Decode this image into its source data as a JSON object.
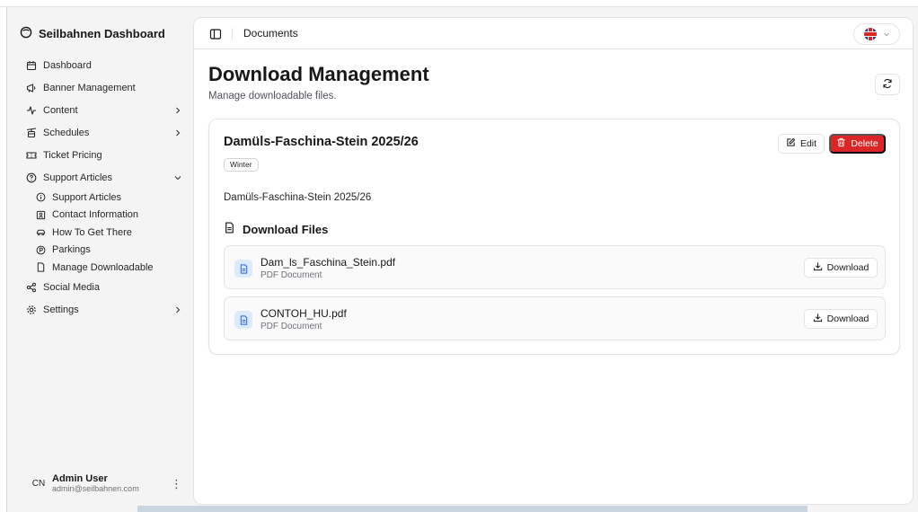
{
  "app": {
    "title": "Seilbahnen Dashboard"
  },
  "sidebar": {
    "items": [
      {
        "label": "Dashboard",
        "icon": "calendar-icon"
      },
      {
        "label": "Banner Management",
        "icon": "megaphone-icon"
      },
      {
        "label": "Content",
        "icon": "activity-icon"
      },
      {
        "label": "Schedules",
        "icon": "cable-car-icon"
      },
      {
        "label": "Ticket Pricing",
        "icon": "ticket-icon"
      },
      {
        "label": "Support Articles",
        "icon": "help-circle-icon"
      }
    ],
    "sub_items": [
      {
        "label": "Support Articles",
        "icon": "info-icon"
      },
      {
        "label": "Contact Information",
        "icon": "contact-icon"
      },
      {
        "label": "How To Get There",
        "icon": "car-icon"
      },
      {
        "label": "Parkings",
        "icon": "parking-icon"
      },
      {
        "label": "Manage Downloadable",
        "icon": "file-icon"
      }
    ],
    "bottom_items": [
      {
        "label": "Social Media",
        "icon": "share-icon"
      },
      {
        "label": "Settings",
        "icon": "gear-icon"
      }
    ]
  },
  "user": {
    "initials": "CN",
    "name": "Admin User",
    "email": "admin@seilbahnen.com"
  },
  "header": {
    "title": "Documents",
    "language": "en-GB"
  },
  "page": {
    "title": "Download Management",
    "subtitle": "Manage downloadable files."
  },
  "card": {
    "title": "Damüls-Faschina-Stein 2025/26",
    "badge": "Winter",
    "description": "Damüls-Faschina-Stein 2025/26",
    "edit_label": "Edit",
    "delete_label": "Delete",
    "files_heading": "Download Files",
    "files": [
      {
        "name": "Dam_ls_Faschina_Stein.pdf",
        "type": "PDF Document",
        "action": "Download"
      },
      {
        "name": "CONTOH_HU.pdf",
        "type": "PDF Document",
        "action": "Download"
      }
    ]
  },
  "colors": {
    "accent_danger": "#dc2626",
    "file_icon_bg": "#dbeafe",
    "file_icon_fg": "#2563eb"
  }
}
